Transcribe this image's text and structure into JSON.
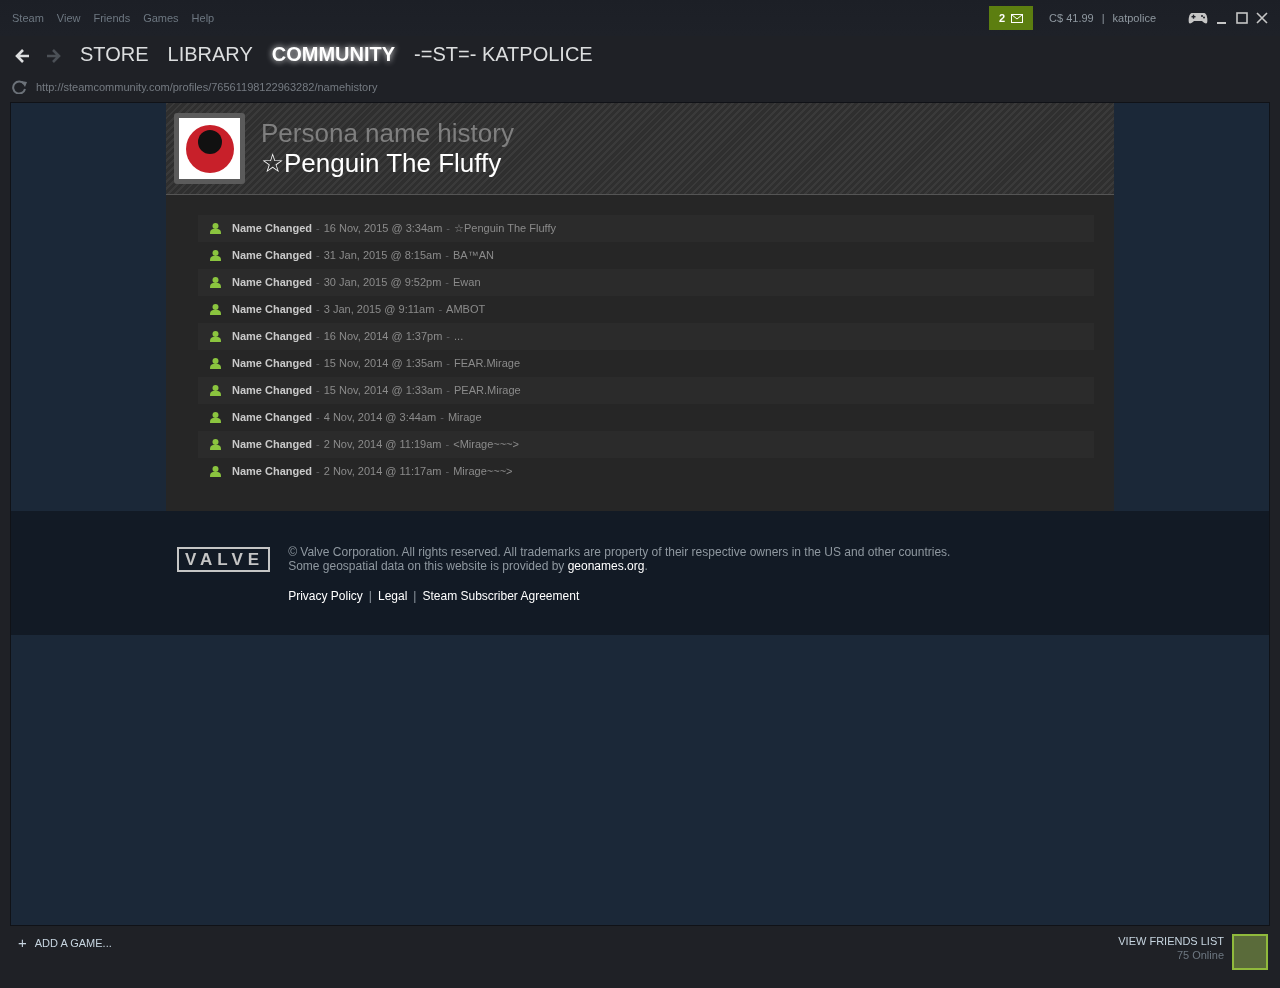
{
  "menu": [
    "Steam",
    "View",
    "Friends",
    "Games",
    "Help"
  ],
  "notifications": {
    "count": "2"
  },
  "account": {
    "wallet": "C$ 41.99",
    "separator": "|",
    "username": "katpolice"
  },
  "navigation": {
    "back_disabled": false,
    "forward_disabled": true,
    "tabs": [
      {
        "label": "STORE",
        "selected": false
      },
      {
        "label": "LIBRARY",
        "selected": false
      },
      {
        "label": "COMMUNITY",
        "selected": true
      },
      {
        "label": "-=ST=- KATPOLICE",
        "selected": false
      }
    ]
  },
  "url": "http://steamcommunity.com/profiles/76561198122963282/namehistory",
  "header": {
    "title": "Persona name history",
    "persona_name": "☆Penguin The Fluffy"
  },
  "history": [
    {
      "label": "Name Changed",
      "sep_1": "-",
      "date": "16 Nov, 2015 @ 3:34am",
      "sep_2": "-",
      "name": "☆Penguin The Fluffy"
    },
    {
      "label": "Name Changed",
      "sep_1": "-",
      "date": "31 Jan, 2015 @ 8:15am",
      "sep_2": "-",
      "name": "BA™AN"
    },
    {
      "label": "Name Changed",
      "sep_1": "-",
      "date": "30 Jan, 2015 @ 9:52pm",
      "sep_2": "-",
      "name": "Ewan"
    },
    {
      "label": "Name Changed",
      "sep_1": "-",
      "date": "3 Jan, 2015 @ 9:11am",
      "sep_2": "-",
      "name": "AMBOT"
    },
    {
      "label": "Name Changed",
      "sep_1": "-",
      "date": "16 Nov, 2014 @ 1:37pm",
      "sep_2": "-",
      "name": "..."
    },
    {
      "label": "Name Changed",
      "sep_1": "-",
      "date": "15 Nov, 2014 @ 1:35am",
      "sep_2": "-",
      "name": "FEAR.Mirage"
    },
    {
      "label": "Name Changed",
      "sep_1": "-",
      "date": "15 Nov, 2014 @ 1:33am",
      "sep_2": "-",
      "name": "PEAR.Mirage"
    },
    {
      "label": "Name Changed",
      "sep_1": "-",
      "date": "4 Nov, 2014 @ 3:44am",
      "sep_2": "-",
      "name": "Mirage"
    },
    {
      "label": "Name Changed",
      "sep_1": "-",
      "date": "2 Nov, 2014 @ 11:19am",
      "sep_2": "-",
      "name": "<Mirage~~~>"
    },
    {
      "label": "Name Changed",
      "sep_1": "-",
      "date": "2 Nov, 2014 @ 11:17am",
      "sep_2": "-",
      "name": "Mirage~~~>"
    }
  ],
  "footer": {
    "logo": "VALVE",
    "copyright": "© Valve Corporation. All rights reserved. All trademarks are property of their respective owners in the US and other countries.",
    "geo_prefix": "Some geospatial data on this website is provided by ",
    "geo_link": "geonames.org",
    "geo_suffix": ".",
    "links": [
      "Privacy Policy",
      "Legal",
      "Steam Subscriber Agreement"
    ],
    "link_separator": "|"
  },
  "bottom_bar": {
    "add_game": "ADD A GAME...",
    "add_icon": "+",
    "friends_label": "VIEW FRIENDS LIST",
    "online": "75 Online"
  }
}
